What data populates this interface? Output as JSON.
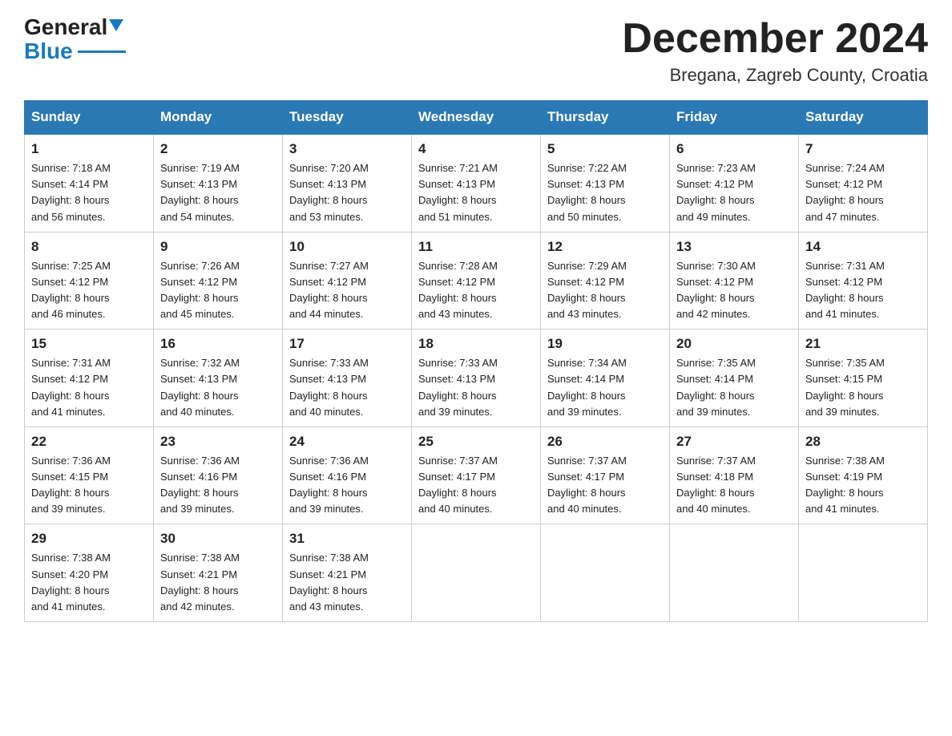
{
  "header": {
    "logo_general": "General",
    "logo_blue": "Blue",
    "month_title": "December 2024",
    "location": "Bregana, Zagreb County, Croatia"
  },
  "days_of_week": [
    "Sunday",
    "Monday",
    "Tuesday",
    "Wednesday",
    "Thursday",
    "Friday",
    "Saturday"
  ],
  "weeks": [
    [
      {
        "day": "1",
        "sunrise": "7:18 AM",
        "sunset": "4:14 PM",
        "daylight": "8 hours and 56 minutes."
      },
      {
        "day": "2",
        "sunrise": "7:19 AM",
        "sunset": "4:13 PM",
        "daylight": "8 hours and 54 minutes."
      },
      {
        "day": "3",
        "sunrise": "7:20 AM",
        "sunset": "4:13 PM",
        "daylight": "8 hours and 53 minutes."
      },
      {
        "day": "4",
        "sunrise": "7:21 AM",
        "sunset": "4:13 PM",
        "daylight": "8 hours and 51 minutes."
      },
      {
        "day": "5",
        "sunrise": "7:22 AM",
        "sunset": "4:13 PM",
        "daylight": "8 hours and 50 minutes."
      },
      {
        "day": "6",
        "sunrise": "7:23 AM",
        "sunset": "4:12 PM",
        "daylight": "8 hours and 49 minutes."
      },
      {
        "day": "7",
        "sunrise": "7:24 AM",
        "sunset": "4:12 PM",
        "daylight": "8 hours and 47 minutes."
      }
    ],
    [
      {
        "day": "8",
        "sunrise": "7:25 AM",
        "sunset": "4:12 PM",
        "daylight": "8 hours and 46 minutes."
      },
      {
        "day": "9",
        "sunrise": "7:26 AM",
        "sunset": "4:12 PM",
        "daylight": "8 hours and 45 minutes."
      },
      {
        "day": "10",
        "sunrise": "7:27 AM",
        "sunset": "4:12 PM",
        "daylight": "8 hours and 44 minutes."
      },
      {
        "day": "11",
        "sunrise": "7:28 AM",
        "sunset": "4:12 PM",
        "daylight": "8 hours and 43 minutes."
      },
      {
        "day": "12",
        "sunrise": "7:29 AM",
        "sunset": "4:12 PM",
        "daylight": "8 hours and 43 minutes."
      },
      {
        "day": "13",
        "sunrise": "7:30 AM",
        "sunset": "4:12 PM",
        "daylight": "8 hours and 42 minutes."
      },
      {
        "day": "14",
        "sunrise": "7:31 AM",
        "sunset": "4:12 PM",
        "daylight": "8 hours and 41 minutes."
      }
    ],
    [
      {
        "day": "15",
        "sunrise": "7:31 AM",
        "sunset": "4:12 PM",
        "daylight": "8 hours and 41 minutes."
      },
      {
        "day": "16",
        "sunrise": "7:32 AM",
        "sunset": "4:13 PM",
        "daylight": "8 hours and 40 minutes."
      },
      {
        "day": "17",
        "sunrise": "7:33 AM",
        "sunset": "4:13 PM",
        "daylight": "8 hours and 40 minutes."
      },
      {
        "day": "18",
        "sunrise": "7:33 AM",
        "sunset": "4:13 PM",
        "daylight": "8 hours and 39 minutes."
      },
      {
        "day": "19",
        "sunrise": "7:34 AM",
        "sunset": "4:14 PM",
        "daylight": "8 hours and 39 minutes."
      },
      {
        "day": "20",
        "sunrise": "7:35 AM",
        "sunset": "4:14 PM",
        "daylight": "8 hours and 39 minutes."
      },
      {
        "day": "21",
        "sunrise": "7:35 AM",
        "sunset": "4:15 PM",
        "daylight": "8 hours and 39 minutes."
      }
    ],
    [
      {
        "day": "22",
        "sunrise": "7:36 AM",
        "sunset": "4:15 PM",
        "daylight": "8 hours and 39 minutes."
      },
      {
        "day": "23",
        "sunrise": "7:36 AM",
        "sunset": "4:16 PM",
        "daylight": "8 hours and 39 minutes."
      },
      {
        "day": "24",
        "sunrise": "7:36 AM",
        "sunset": "4:16 PM",
        "daylight": "8 hours and 39 minutes."
      },
      {
        "day": "25",
        "sunrise": "7:37 AM",
        "sunset": "4:17 PM",
        "daylight": "8 hours and 40 minutes."
      },
      {
        "day": "26",
        "sunrise": "7:37 AM",
        "sunset": "4:17 PM",
        "daylight": "8 hours and 40 minutes."
      },
      {
        "day": "27",
        "sunrise": "7:37 AM",
        "sunset": "4:18 PM",
        "daylight": "8 hours and 40 minutes."
      },
      {
        "day": "28",
        "sunrise": "7:38 AM",
        "sunset": "4:19 PM",
        "daylight": "8 hours and 41 minutes."
      }
    ],
    [
      {
        "day": "29",
        "sunrise": "7:38 AM",
        "sunset": "4:20 PM",
        "daylight": "8 hours and 41 minutes."
      },
      {
        "day": "30",
        "sunrise": "7:38 AM",
        "sunset": "4:21 PM",
        "daylight": "8 hours and 42 minutes."
      },
      {
        "day": "31",
        "sunrise": "7:38 AM",
        "sunset": "4:21 PM",
        "daylight": "8 hours and 43 minutes."
      },
      null,
      null,
      null,
      null
    ]
  ],
  "labels": {
    "sunrise": "Sunrise:",
    "sunset": "Sunset:",
    "daylight": "Daylight:"
  }
}
